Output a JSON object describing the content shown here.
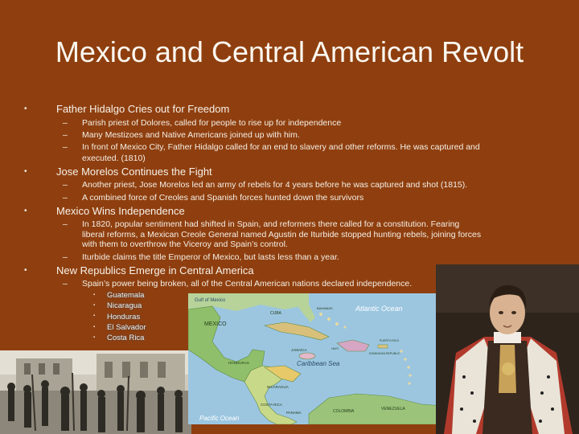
{
  "title": "Mexico and Central American Revolt",
  "sections": [
    {
      "heading": "Father Hidalgo Cries out for Freedom",
      "points": [
        "Parish priest of Dolores, called for people to rise up for independence",
        "Many Mestizoes and Native Americans joined up with him.",
        "In front of Mexico City, Father Hidalgo called for an end to slavery and other reforms.  He was captured and",
        "executed. (1810)"
      ]
    },
    {
      "heading": "Jose Morelos Continues the Fight",
      "points": [
        "Another priest, Jose Morelos led an army of rebels for 4 years before he was captured and shot (1815).",
        "A combined force of Creoles and Spanish forces hunted down the survivors"
      ]
    },
    {
      "heading": "Mexico Wins Independence",
      "points": [
        "In 1820, popular sentiment had shifted in Spain, and reformers there called for a constitution.  Fearing",
        "liberal reforms, a Mexican Creole General named Agustin de Iturbide stopped hunting rebels, joining forces",
        "with them to overthrow the Viceroy and Spain’s control.",
        "Iturbide claims the title Emperor of Mexico, but lasts less than a year."
      ]
    },
    {
      "heading": "New Republics Emerge in Central America",
      "points": [
        "Spain’s power being broken, all of the Central American nations declared independence."
      ],
      "nations": [
        "Guatemala",
        "Nicaragua",
        "Honduras",
        "El Salvador",
        "Costa Rica"
      ]
    }
  ],
  "map": {
    "gulf": "Gulf of Mexico",
    "atlantic": "Atlantic Ocean",
    "caribbean": "Caribbean Sea",
    "pacific": "Pacific Ocean",
    "mexico": "MEXICO",
    "cuba": "CUBA",
    "jamaica": "JAMAICA",
    "honduras": "HONDURAS",
    "nicaragua": "NICARAGUA",
    "costa_rica": "COSTA RICA",
    "panama": "PANAMA",
    "colombia": "COLOMBIA",
    "venezuela": "VENEZUELA",
    "bahamas": "BAHAMAS",
    "dominican": "DOMINICAN REPUBLIC",
    "haiti": "HAITI",
    "puerto_rico": "PUERTO RICO"
  },
  "colors": {
    "background": "#8f3f0f",
    "text": "#f4efe6",
    "sea": "#9cc6e0",
    "land": "#8fbf6a"
  }
}
